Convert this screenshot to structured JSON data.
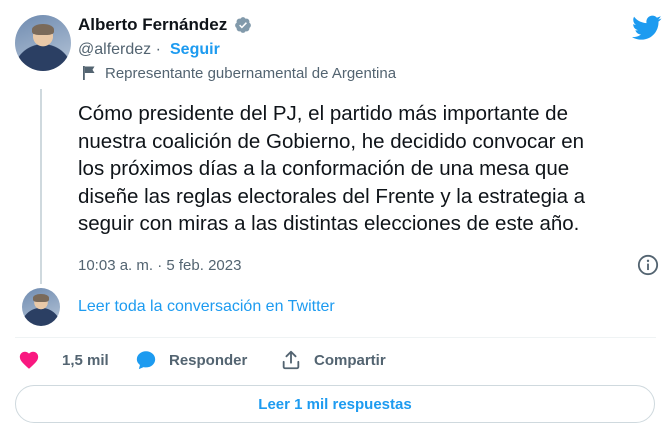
{
  "author": {
    "name": "Alberto Fernández",
    "handle": "@alferdez",
    "separator": " · ",
    "follow_label": "Seguir",
    "affiliation": "Representante gubernamental de Argentina"
  },
  "tweet": {
    "text": "Cómo presidente del PJ, el partido más importante de\nnuestra coalición de Gobierno, he decidido convocar en\nlos próximos días a la conformación de una mesa que\ndiseñe las reglas electorales del Frente y la estrategia a\nseguir con miras a las distintas elecciones de este año.",
    "timestamp": "10:03 a. m. · 5 feb. 2023"
  },
  "conversation": {
    "read_label": "Leer toda la conversación en Twitter"
  },
  "actions": {
    "like_count": "1,5 mil",
    "reply_label": "Responder",
    "share_label": "Compartir"
  },
  "replies_button_label": "Leer 1 mil respuestas",
  "colors": {
    "accent": "#1d9bf0",
    "like": "#f91880",
    "text_secondary": "#536471"
  },
  "icons": [
    "verified-badge-icon",
    "flag-icon",
    "twitter-bird-icon",
    "info-icon",
    "heart-icon",
    "reply-bubble-icon",
    "share-icon"
  ]
}
